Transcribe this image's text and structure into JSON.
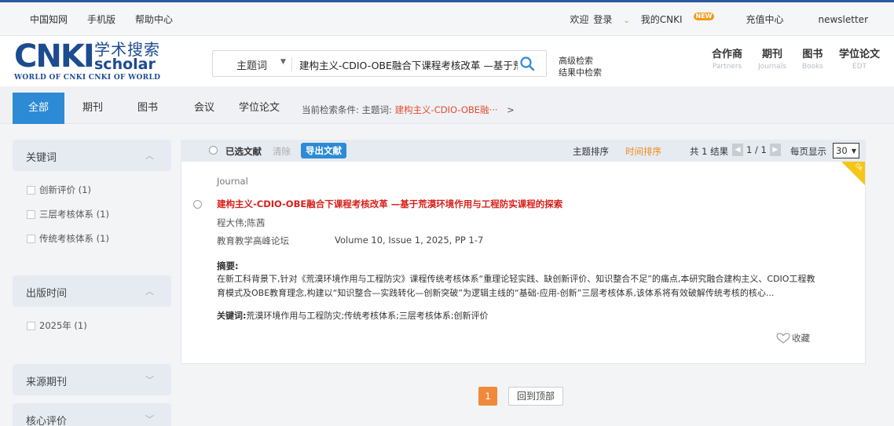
{
  "topbar": {
    "left_links": [
      "中国知网",
      "手机版",
      "帮助中心"
    ],
    "welcome": "欢迎",
    "login": "登录",
    "my_cnki": "我的CNKI",
    "new_badge": "NEW",
    "recharge": "充值中心",
    "newsletter": "newsletter"
  },
  "logo": {
    "main": "CNKI",
    "cn": "学术搜索",
    "scholar": "scholar",
    "subtitle": "WORLD OF CNKI CNKI OF WORLD"
  },
  "search": {
    "field": "主题词",
    "value": "建构主义-CDIO-OBE融合下课程考核改革 —基于荒漠环境作用与工程防实",
    "advanced": "高级检索",
    "within": "结果中检索"
  },
  "categories": [
    {
      "cn": "合作商",
      "en": "Partners"
    },
    {
      "cn": "期刊",
      "en": "Journals"
    },
    {
      "cn": "图书",
      "en": "Books"
    },
    {
      "cn": "学位论文",
      "en": "EDT"
    }
  ],
  "tabs": [
    "全部",
    "期刊",
    "图书",
    "会议",
    "学位论文"
  ],
  "crumb": {
    "label": "当前检索条件: 主题词:",
    "value": "建构主义-CDIO-OBE融···",
    "arrow": ">"
  },
  "facets": [
    {
      "title": "关键词",
      "items": [
        "创新评价 (1)",
        "三层考核体系 (1)",
        "传统考核体系 (1)"
      ]
    },
    {
      "title": "出版时间",
      "items": [
        "2025年 (1)"
      ]
    },
    {
      "title": "来源期刊",
      "items": []
    },
    {
      "title": "核心评价",
      "items": []
    }
  ],
  "toolbar": {
    "selected": "已选文献",
    "clear": "清除",
    "export": "导出文献",
    "sort_topic": "主题排序",
    "sort_time": "时间排序",
    "total": "共 1 结果",
    "page": "1 / 1",
    "per_page_label": "每页显示",
    "per_page": "30"
  },
  "result": {
    "type": "Journal",
    "oa": "OA",
    "title": "建构主义-CDIO-OBE融合下课程考核改革 —基于荒漠环境作用与工程防实课程的探索",
    "authors": "程大伟;陈茜",
    "source": "教育教学高峰论坛",
    "volume": "Volume 10, Issue 1, 2025, PP 1-7",
    "abstract_label": "摘要:",
    "abstract": "在新工科背景下,针对《荒漠环境作用与工程防灾》课程传统考核体系“重理论轻实践、缺创新评价、知识整合不足”的痛点,本研究融合建构主义、CDIO工程教育模式及OBE教育理念,构建以“知识整合—实践转化—创新突破”为逻辑主线的“基础-应用-创新”三层考核体系,该体系将有效破解传统考核的核心...",
    "keywords_label": "关键词:",
    "keywords": "荒漠环境作用与工程防灾;传统考核体系;三层考核体系;创新评价",
    "favorite": "收藏"
  },
  "pager": {
    "current": "1",
    "top": "回到顶部"
  }
}
